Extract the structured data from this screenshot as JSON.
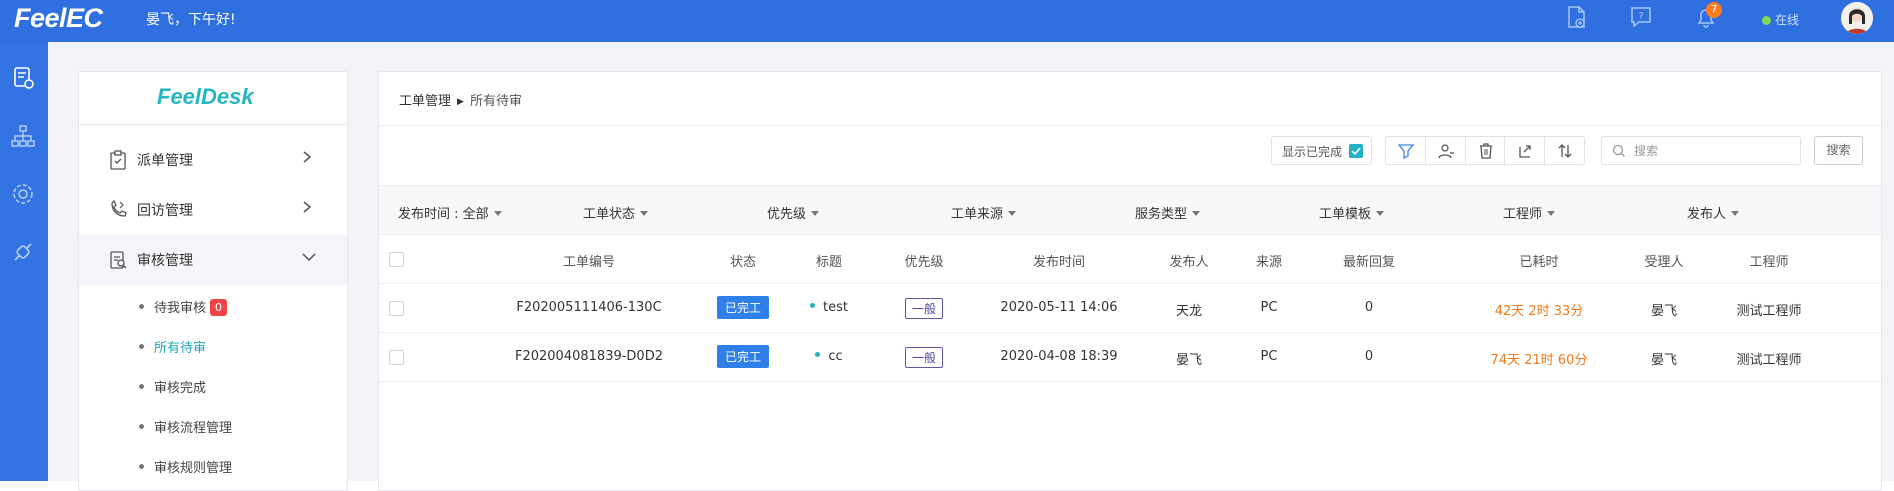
{
  "topbar": {
    "logo": "FeelEC",
    "greeting": "晏飞，下午好!",
    "notification_count": "7",
    "status_text": "在线",
    "icons": [
      "new-document-icon",
      "help-icon",
      "bell-icon"
    ]
  },
  "leftrail": {
    "icons": [
      "ticket-settings-icon",
      "org-chart-icon",
      "settings-icon",
      "plugin-icon"
    ]
  },
  "sidenav": {
    "logo": "FeelDesk",
    "items": [
      {
        "label": "派单管理",
        "icon": "dispatch-icon"
      },
      {
        "label": "回访管理",
        "icon": "phone-callback-icon"
      },
      {
        "label": "审核管理",
        "icon": "audit-icon"
      }
    ],
    "sub_items": [
      {
        "label": "待我审核",
        "badge": "0"
      },
      {
        "label": "所有待审"
      },
      {
        "label": "审核完成"
      },
      {
        "label": "审核流程管理"
      },
      {
        "label": "审核规则管理"
      }
    ]
  },
  "breadcrumb": {
    "root": "工单管理",
    "current": "所有待审"
  },
  "toolbar": {
    "show_done_label": "显示已完成",
    "show_done_checked": true,
    "search_placeholder": "搜索",
    "search_button": "搜索",
    "action_icons": [
      "filter-icon",
      "assign-user-icon",
      "trash-icon",
      "export-icon",
      "sort-icon"
    ]
  },
  "filters": [
    "发布时间 : 全部",
    "工单状态",
    "优先级",
    "工单来源",
    "服务类型",
    "工单模板",
    "工程师",
    "发布人"
  ],
  "table": {
    "columns": [
      "工单编号",
      "状态",
      "标题",
      "优先级",
      "发布时间",
      "发布人",
      "来源",
      "最新回复",
      "已耗时",
      "受理人",
      "工程师"
    ],
    "rows": [
      {
        "id": "F202005111406-130C",
        "status": "已完工",
        "title": "test",
        "priority": "一般",
        "time": "2020-05-11 14:06",
        "publisher": "天龙",
        "source": "PC",
        "reply": "0",
        "elapsed": "42天 2时 33分",
        "assignee": "晏飞",
        "engineer": "测试工程师"
      },
      {
        "id": "F202004081839-D0D2",
        "status": "已完工",
        "title": "cc",
        "priority": "一般",
        "time": "2020-04-08 18:39",
        "publisher": "晏飞",
        "source": "PC",
        "reply": "0",
        "elapsed": "74天 21时 60分",
        "assignee": "晏飞",
        "engineer": "测试工程师"
      }
    ]
  },
  "colors": {
    "topbar": "#2f6fe0",
    "accent_teal": "#22b1c4",
    "status_blue": "#2f7fe8",
    "elapsed_orange": "#f07a18"
  }
}
